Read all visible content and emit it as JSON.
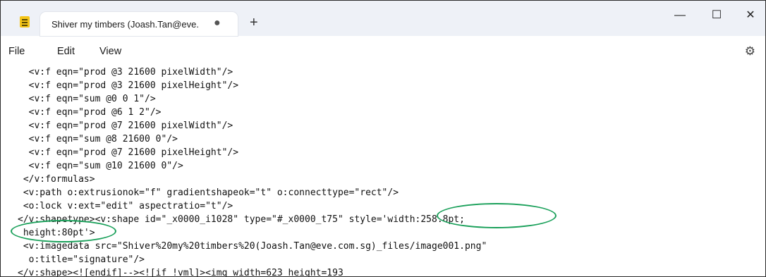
{
  "titlebar": {
    "tab_title": "Shiver my timbers (Joash.Tan@eve.",
    "tab_modified_dot": "●",
    "new_tab": "+",
    "minimize": "—",
    "maximize": "☐",
    "close": "✕"
  },
  "menu": {
    "items": [
      "File",
      "Edit",
      "View"
    ],
    "settings_icon": "⚙"
  },
  "editor": {
    "lines": [
      "  <v:f eqn=\"prod @3 21600 pixelWidth\"/>",
      "  <v:f eqn=\"prod @3 21600 pixelHeight\"/>",
      "  <v:f eqn=\"sum @0 0 1\"/>",
      "  <v:f eqn=\"prod @6 1 2\"/>",
      "  <v:f eqn=\"prod @7 21600 pixelWidth\"/>",
      "  <v:f eqn=\"sum @8 21600 0\"/>",
      "  <v:f eqn=\"prod @7 21600 pixelHeight\"/>",
      "  <v:f eqn=\"sum @10 21600 0\"/>",
      " </v:formulas>",
      " <v:path o:extrusionok=\"f\" gradientshapeok=\"t\" o:connecttype=\"rect\"/>",
      " <o:lock v:ext=\"edit\" aspectratio=\"t\"/>",
      "</v:shapetype><v:shape id=\"_x0000_i1028\" type=\"#_x0000_t75\" style='width:258.8pt;",
      " height:80pt'>",
      " <v:imagedata src=\"Shiver%20my%20timbers%20(Joash.Tan@eve.com.sg)_files/image001.png\"",
      "  o:title=\"signature\"/>",
      "</v:shape><![endif]--><![if !vml]><img width=623 height=193"
    ]
  },
  "annotations": {
    "color": "#1aa05a"
  }
}
